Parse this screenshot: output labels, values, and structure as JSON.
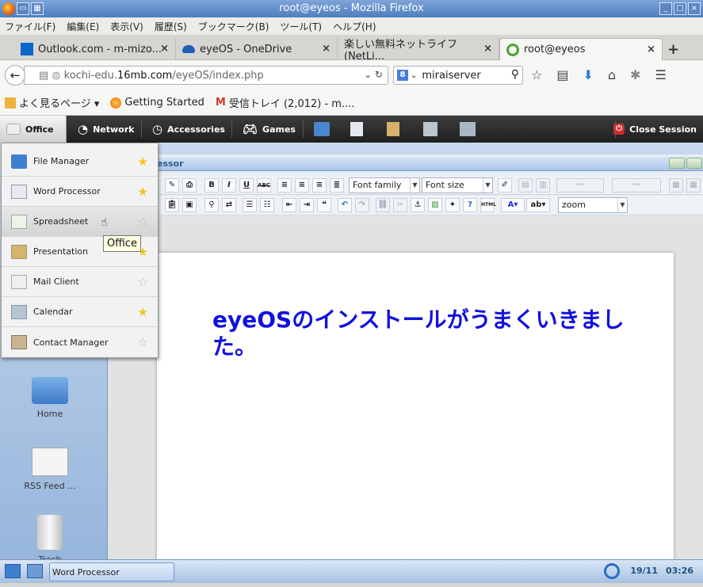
{
  "window": {
    "title": "root@eyeos - Mozilla Firefox"
  },
  "menubar": [
    "ファイル(F)",
    "編集(E)",
    "表示(V)",
    "履歴(S)",
    "ブックマーク(B)",
    "ツール(T)",
    "ヘルプ(H)"
  ],
  "tabs": [
    {
      "label": "Outlook.com - m-mizo...",
      "close": "×"
    },
    {
      "label": "eyeOS - OneDrive",
      "close": "×"
    },
    {
      "label": "楽しい無料ネットライフ(NetLi...",
      "close": "×"
    },
    {
      "label": "root@eyeos",
      "close": "×"
    }
  ],
  "newtab": "+",
  "url": {
    "prefix": "kochi-edu.",
    "host": "16mb.com",
    "path": "/eyeOS/index.php"
  },
  "search": {
    "value": "miraiserver",
    "engine": "8"
  },
  "bookmarks": [
    {
      "label": "よく見るページ ▾"
    },
    {
      "label": "Getting Started"
    },
    {
      "label": "受信トレイ (2,012) - m...."
    }
  ],
  "eyebar": {
    "office": "Office",
    "network": "Network",
    "accessories": "Accessories",
    "games": "Games",
    "close_session": "Close Session"
  },
  "dropdown": {
    "items": [
      {
        "label": "File Manager",
        "star": "★",
        "fav": true
      },
      {
        "label": "Word Processor",
        "star": "★",
        "fav": true
      },
      {
        "label": "Spreadsheet",
        "star": "☆",
        "fav": false
      },
      {
        "label": "Presentation",
        "star": "★",
        "fav": true
      },
      {
        "label": "Mail Client",
        "star": "☆",
        "fav": false
      },
      {
        "label": "Calendar",
        "star": "★",
        "fav": true
      },
      {
        "label": "Contact Manager",
        "star": "☆",
        "fav": false
      }
    ],
    "tooltip": "Office"
  },
  "wp": {
    "title_fragment": "essor",
    "font_family": "Font family",
    "font_size": "Font size",
    "zoom": "zoom",
    "bold": "B",
    "italic": "I",
    "underline": "U",
    "strike": "ABC",
    "content": "eyeOSのインストールがうまくいきました。"
  },
  "desktop_icons": [
    {
      "label": "Home"
    },
    {
      "label": "RSS Feed ..."
    },
    {
      "label": "Trash"
    }
  ],
  "taskbar": {
    "task": "Word Processor",
    "date": "19/11",
    "time": "03:26"
  },
  "colors": {
    "accent": "#1111dd",
    "titlebar": "#4f7dbf",
    "star": "#f3c21b"
  }
}
